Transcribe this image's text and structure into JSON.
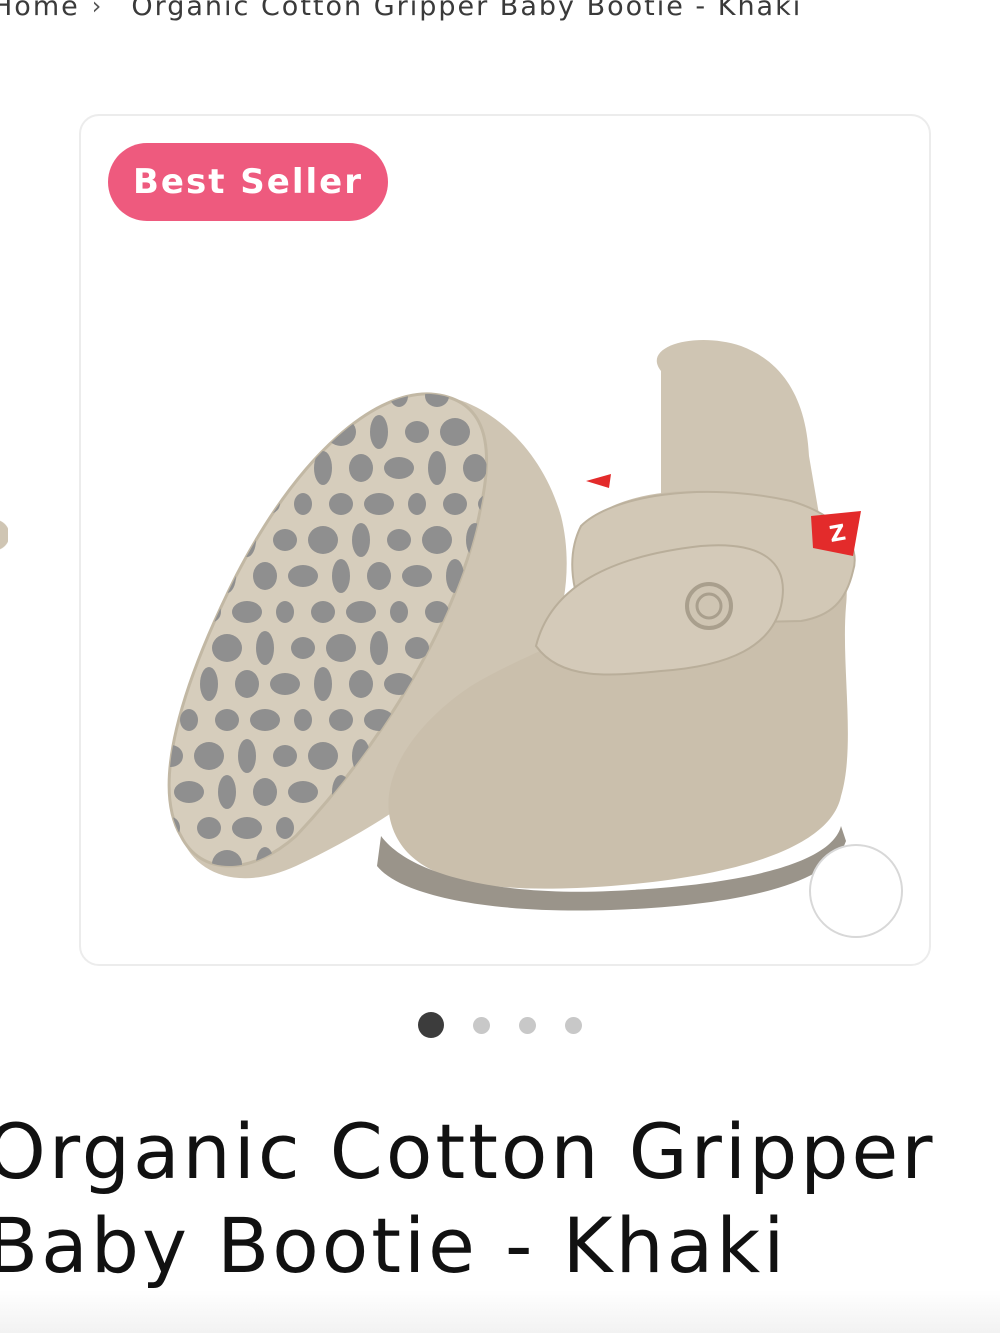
{
  "breadcrumb": {
    "home": "Home",
    "separator": "›",
    "current": "Organic Cotton Gripper Baby Bootie - Khaki"
  },
  "gallery": {
    "badge": "Best Seller",
    "image_alt": "Organic Cotton Gripper Baby Bootie - Khaki",
    "slide_count": 4,
    "active_slide": 1,
    "zoom_icon": "circle-icon"
  },
  "product": {
    "title": "Organic Cotton Gripper Baby Bootie - Khaki"
  },
  "colors": {
    "badge_bg": "#ee5a7e",
    "khaki": "#cfc5b3",
    "grip_dots": "#8f8f8f",
    "tag_red": "#e32b2b"
  }
}
